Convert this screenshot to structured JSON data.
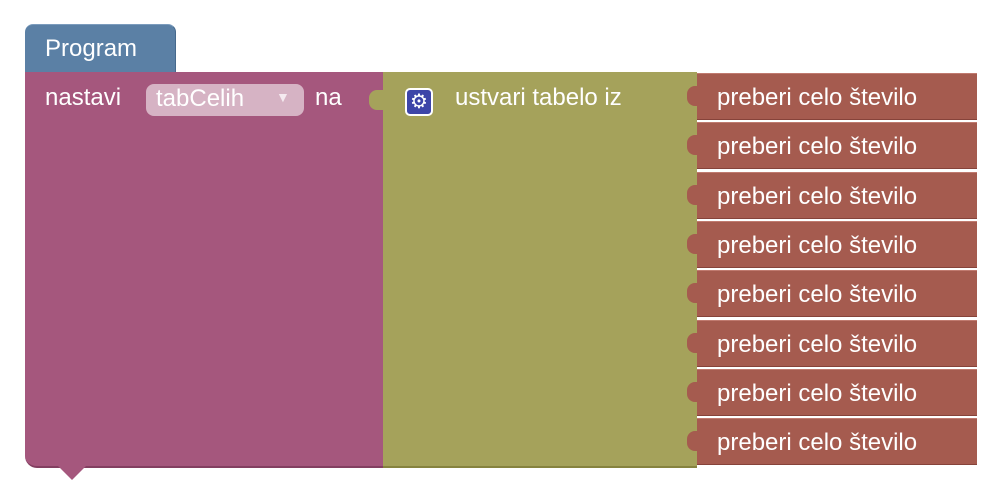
{
  "workspace": {
    "hat_label": "Program",
    "set_block": {
      "prefix": "nastavi",
      "variable": "tabCelih",
      "dropdown_arrow": "▼",
      "suffix": "na"
    },
    "list_block": {
      "icon": "gear-icon",
      "label": "ustvari tabelo iz"
    },
    "items": [
      {
        "label": "preberi celo število"
      },
      {
        "label": "preberi celo število"
      },
      {
        "label": "preberi celo število"
      },
      {
        "label": "preberi celo število"
      },
      {
        "label": "preberi celo število"
      },
      {
        "label": "preberi celo število"
      },
      {
        "label": "preberi celo število"
      },
      {
        "label": "preberi celo število"
      }
    ]
  },
  "colors": {
    "hat": "#5b80a5",
    "set_block": "#a5577d",
    "list_block": "#a5a25b",
    "item_block": "#a55b4f",
    "gear_icon": "#3d45a8"
  }
}
